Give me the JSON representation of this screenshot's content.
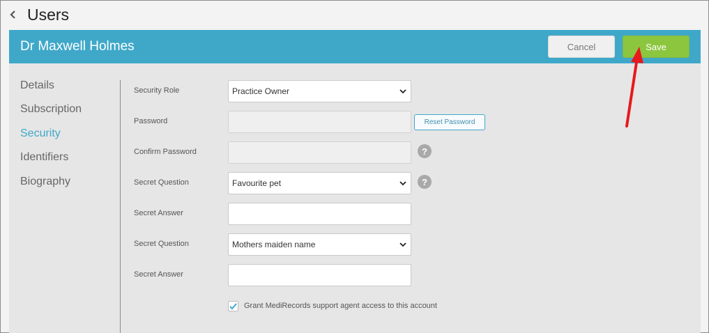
{
  "page": {
    "title": "Users"
  },
  "user_bar": {
    "name": "Dr Maxwell Holmes",
    "cancel_label": "Cancel",
    "save_label": "Save"
  },
  "side_nav": {
    "items": [
      {
        "label": "Details",
        "active": false
      },
      {
        "label": "Subscription",
        "active": false
      },
      {
        "label": "Security",
        "active": true
      },
      {
        "label": "Identifiers",
        "active": false
      },
      {
        "label": "Biography",
        "active": false
      }
    ]
  },
  "form": {
    "security_role": {
      "label": "Security Role",
      "value": "Practice Owner"
    },
    "password": {
      "label": "Password",
      "value": "",
      "reset_label": "Reset Password"
    },
    "confirm_password": {
      "label": "Confirm Password",
      "value": "",
      "help": "?"
    },
    "secret_question_1": {
      "label": "Secret Question",
      "value": "Favourite pet",
      "help": "?"
    },
    "secret_answer_1": {
      "label": "Secret Answer",
      "value": ""
    },
    "secret_question_2": {
      "label": "Secret Question",
      "value": "Mothers maiden name"
    },
    "secret_answer_2": {
      "label": "Secret Answer",
      "value": ""
    },
    "grant_access": {
      "label": "Grant MediRecords support agent access to this account",
      "checked": true
    }
  },
  "colors": {
    "accent": "#3fa8c9",
    "save": "#8cc63f",
    "annotation_arrow": "#e8181e"
  },
  "icons": {
    "back": "chevron-left-icon",
    "select": "chevron-down-icon",
    "help": "question-circle-icon",
    "check": "checkmark-icon"
  }
}
